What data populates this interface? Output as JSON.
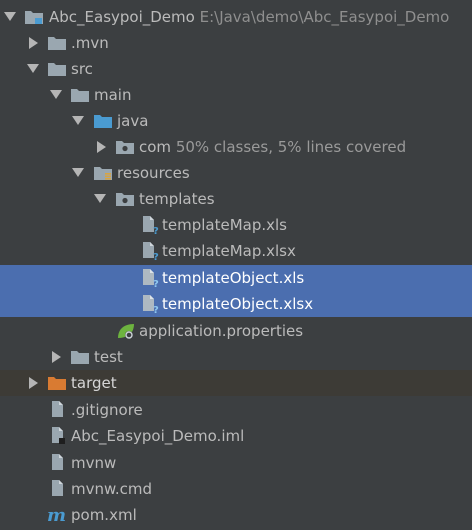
{
  "project_tree": {
    "root": {
      "name": "Abc_Easypoi_Demo",
      "path": "E:\\Java\\demo\\Abc_Easypoi_Demo"
    },
    "mvn": ".mvn",
    "src": "src",
    "main": "main",
    "java": "java",
    "com": {
      "name": "com",
      "coverage": "50% classes, 5% lines covered"
    },
    "resources": "resources",
    "templates": "templates",
    "template_files": [
      "templateMap.xls",
      "templateMap.xlsx",
      "templateObject.xls",
      "templateObject.xlsx"
    ],
    "application_properties": "application.properties",
    "test": "test",
    "target": "target",
    "root_files": [
      ".gitignore",
      "Abc_Easypoi_Demo.iml",
      "mvnw",
      "mvnw.cmd",
      "pom.xml"
    ]
  },
  "colors": {
    "background": "#3c3f41",
    "selection": "#4b6eaf",
    "folder": "#9aa7b0",
    "java_folder": "#4a9bd1",
    "excluded_folder": "#d97b32",
    "spring": "#6db33f"
  }
}
